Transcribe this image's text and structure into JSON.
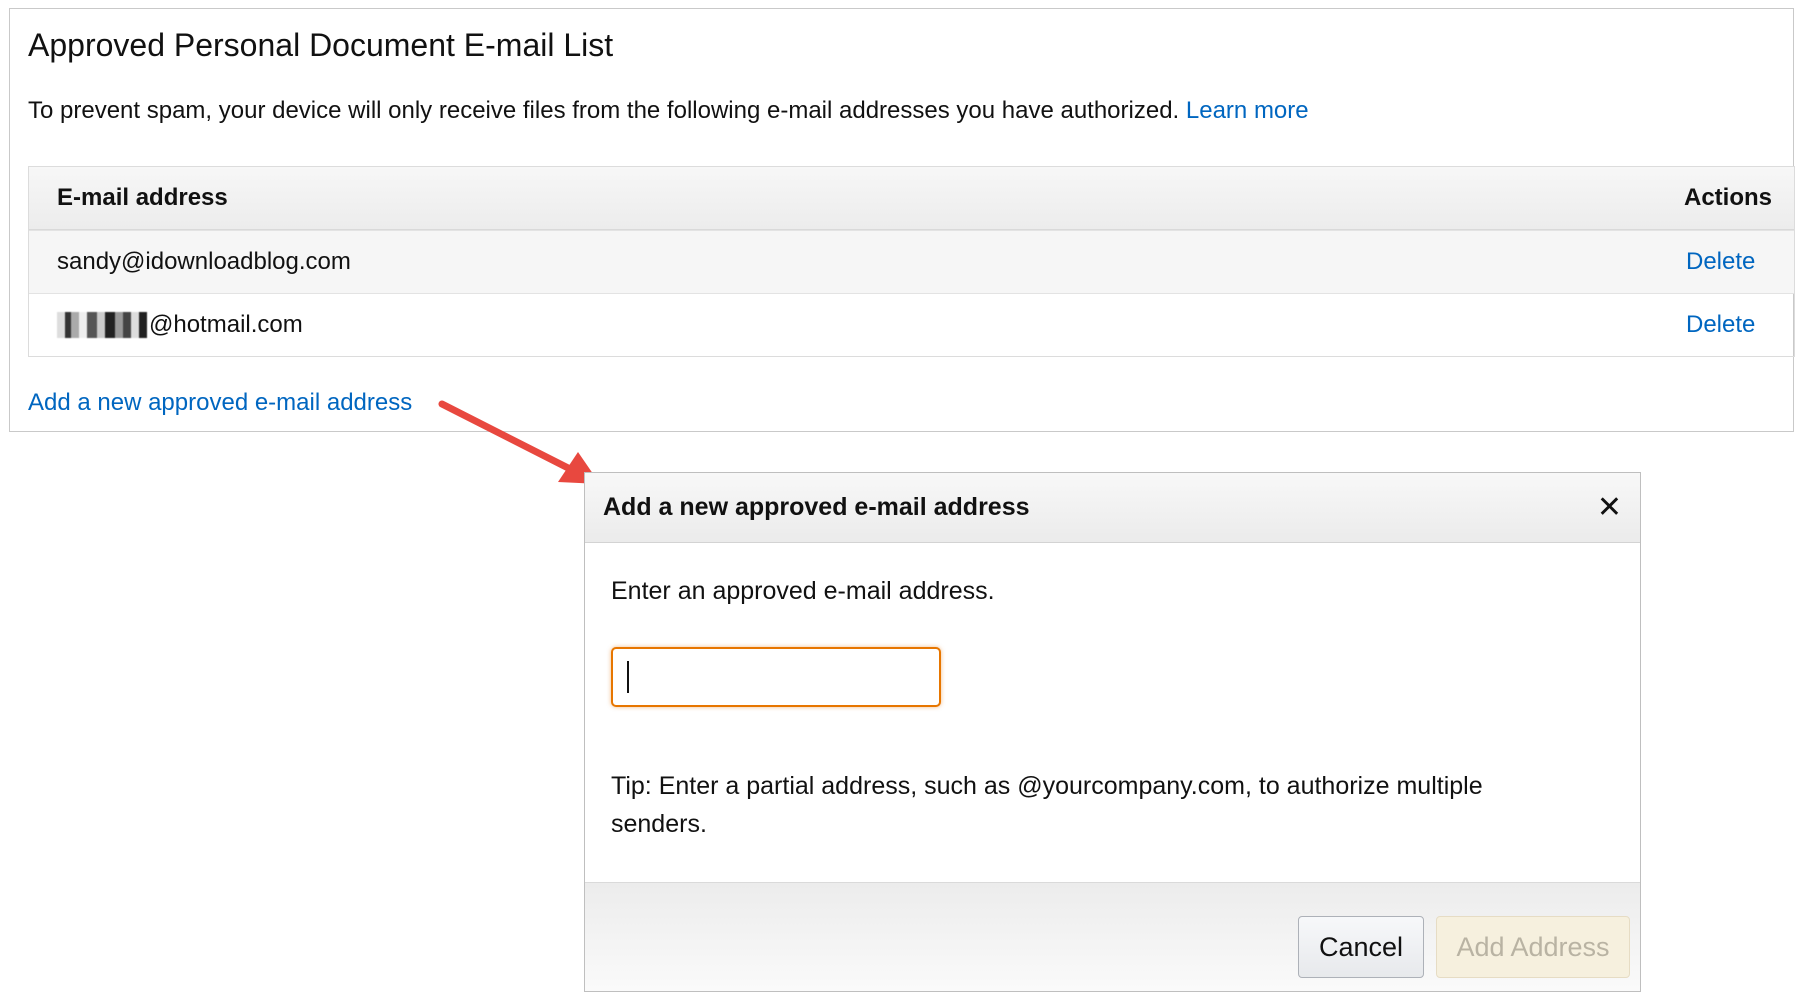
{
  "panel": {
    "title": "Approved Personal Document E-mail List",
    "intro": "To prevent spam, your device will only receive files from the following e-mail addresses you have authorized.",
    "learn_more": "Learn more",
    "table": {
      "col_email": "E-mail address",
      "col_actions": "Actions",
      "rows": [
        {
          "email": "sandy@idownloadblog.com",
          "action": "Delete"
        },
        {
          "email": "@hotmail.com",
          "action": "Delete"
        }
      ]
    },
    "add_link": "Add a new approved e-mail address"
  },
  "dialog": {
    "title": "Add a new approved e-mail address",
    "close_icon": "close-icon",
    "prompt": "Enter an approved e-mail address.",
    "input_value": "",
    "tip": "Tip: Enter a partial address, such as @yourcompany.com, to authorize multiple senders.",
    "cancel_label": "Cancel",
    "add_label": "Add Address"
  },
  "colors": {
    "link": "#0066c0",
    "input_focus": "#e77600",
    "arrow": "#e8483f",
    "add_button_bg": "#f6f0de"
  }
}
